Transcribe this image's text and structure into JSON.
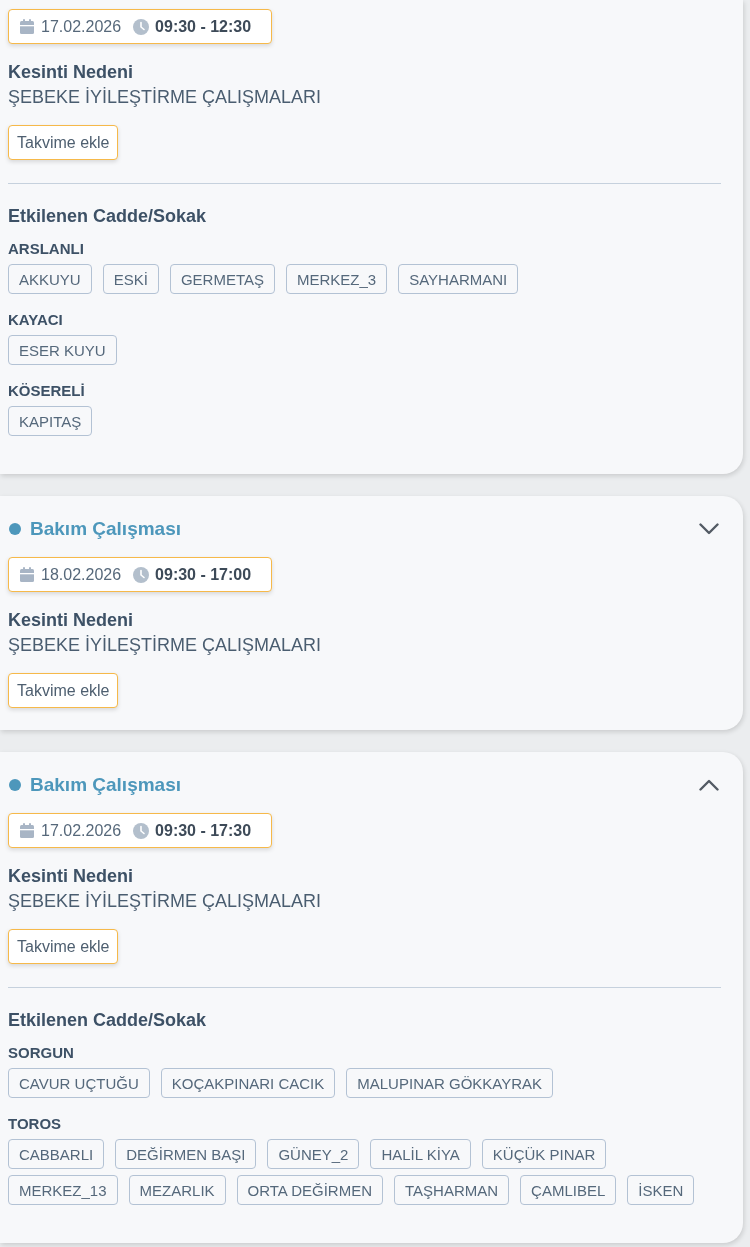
{
  "cards": [
    {
      "expanded": true,
      "date": "17.02.2026",
      "time": "09:30 - 12:30",
      "reason_label": "Kesinti Nedeni",
      "reason": "ŞEBEKE İYİLEŞTİRME ÇALIŞMALARI",
      "calendar_button": "Takvime ekle",
      "affected_label": "Etkilenen Cadde/Sokak",
      "areas": [
        {
          "name": "ARSLANLI",
          "streets": [
            "AKKUYU",
            "ESKİ",
            "GERMETAŞ",
            "MERKEZ_3",
            "SAYHARMANI"
          ]
        },
        {
          "name": "KAYACI",
          "streets": [
            "ESER KUYU"
          ]
        },
        {
          "name": "KÖSERELİ",
          "streets": [
            "KAPITAŞ"
          ]
        }
      ]
    },
    {
      "category": "Bakım Çalışması",
      "expanded": false,
      "date": "18.02.2026",
      "time": "09:30 - 17:00",
      "reason_label": "Kesinti Nedeni",
      "reason": "ŞEBEKE İYİLEŞTİRME ÇALIŞMALARI",
      "calendar_button": "Takvime ekle"
    },
    {
      "category": "Bakım Çalışması",
      "expanded": true,
      "date": "17.02.2026",
      "time": "09:30 - 17:30",
      "reason_label": "Kesinti Nedeni",
      "reason": "ŞEBEKE İYİLEŞTİRME ÇALIŞMALARI",
      "calendar_button": "Takvime ekle",
      "affected_label": "Etkilenen Cadde/Sokak",
      "areas": [
        {
          "name": "SORGUN",
          "streets": [
            "CAVUR UÇTUĞU",
            "KOÇAKPINARI CACIK",
            "MALUPINAR GÖKKAYRAK"
          ]
        },
        {
          "name": "TOROS",
          "streets": [
            "CABBARLI",
            "DEĞİRMEN BAŞI",
            "GÜNEY_2",
            "HALİL KİYA",
            "KÜÇÜK PINAR",
            "MERKEZ_13",
            "MEZARLIK",
            "ORTA DEĞİRMEN",
            "TAŞHARMAN",
            "ÇAMLIBEL",
            "İSKEN"
          ]
        }
      ]
    }
  ]
}
